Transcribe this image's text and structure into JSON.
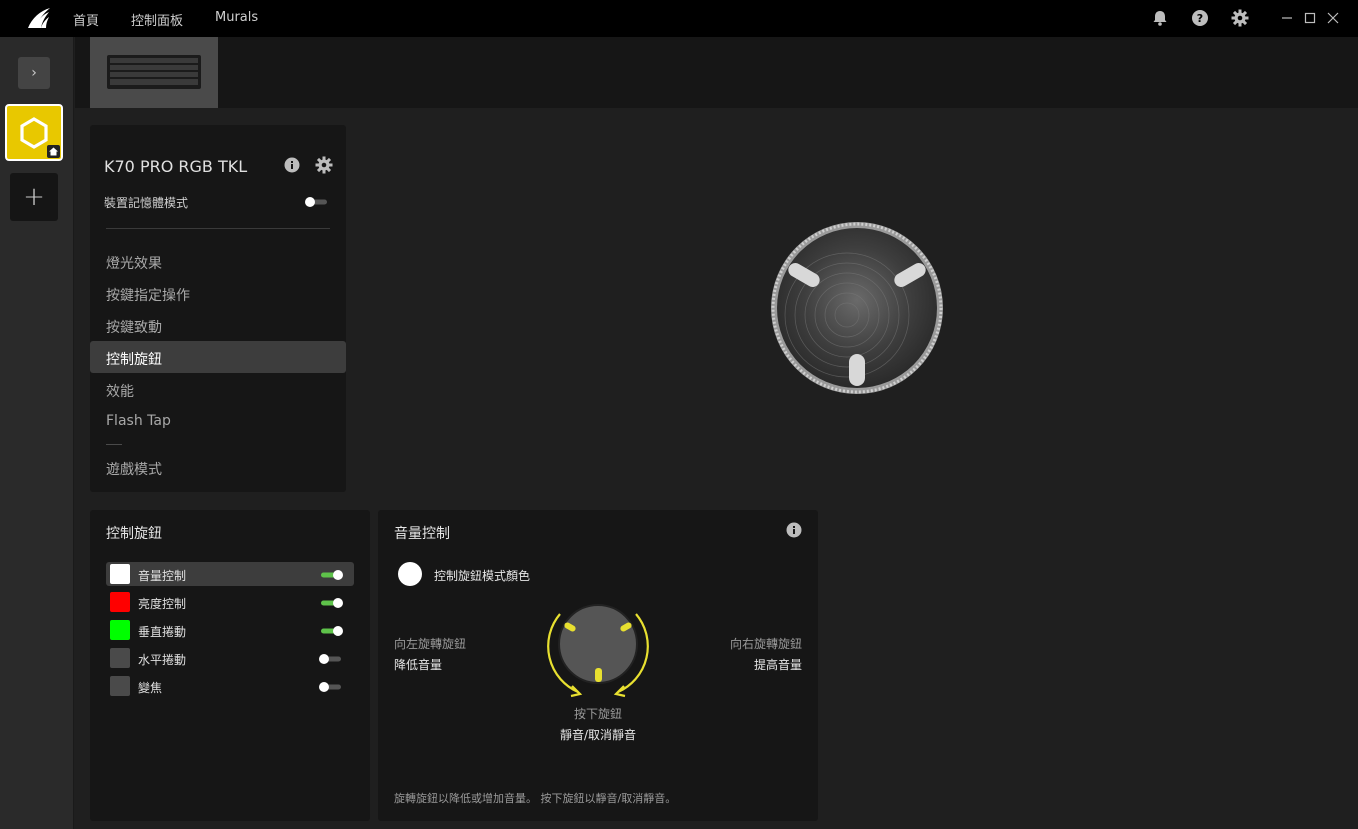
{
  "topbar": {
    "nav": [
      "首頁",
      "控制面板",
      "Murals"
    ]
  },
  "device": {
    "name": "K70 PRO RGB TKL",
    "memory_mode_label": "裝置記憶體模式",
    "memory_mode_on": false
  },
  "menu": {
    "items": [
      "燈光效果",
      "按鍵指定操作",
      "按鍵致動",
      "控制旋鈕",
      "效能",
      "Flash Tap",
      "遊戲模式"
    ],
    "active_index": 3
  },
  "dial_list": {
    "title": "控制旋鈕",
    "items": [
      {
        "label": "音量控制",
        "color": "#ffffff",
        "enabled": true
      },
      {
        "label": "亮度控制",
        "color": "#ff0000",
        "enabled": true
      },
      {
        "label": "垂直捲動",
        "color": "#00ff00",
        "enabled": true
      },
      {
        "label": "水平捲動",
        "color": "#4a4a4a",
        "enabled": false
      },
      {
        "label": "變焦",
        "color": "#4a4a4a",
        "enabled": false
      }
    ]
  },
  "volume": {
    "title": "音量控制",
    "mode_color_label": "控制旋鈕模式顏色",
    "mode_color": "#ffffff",
    "left_title": "向左旋轉旋鈕",
    "left_action": "降低音量",
    "right_title": "向右旋轉旋鈕",
    "right_action": "提高音量",
    "press_title": "按下旋鈕",
    "press_action": "靜音/取消靜音",
    "description": "旋轉旋鈕以降低或增加音量。 按下旋鈕以靜音/取消靜音。"
  },
  "colors": {
    "accent": "#e8c800",
    "toggle_on": "#5ec24a"
  }
}
